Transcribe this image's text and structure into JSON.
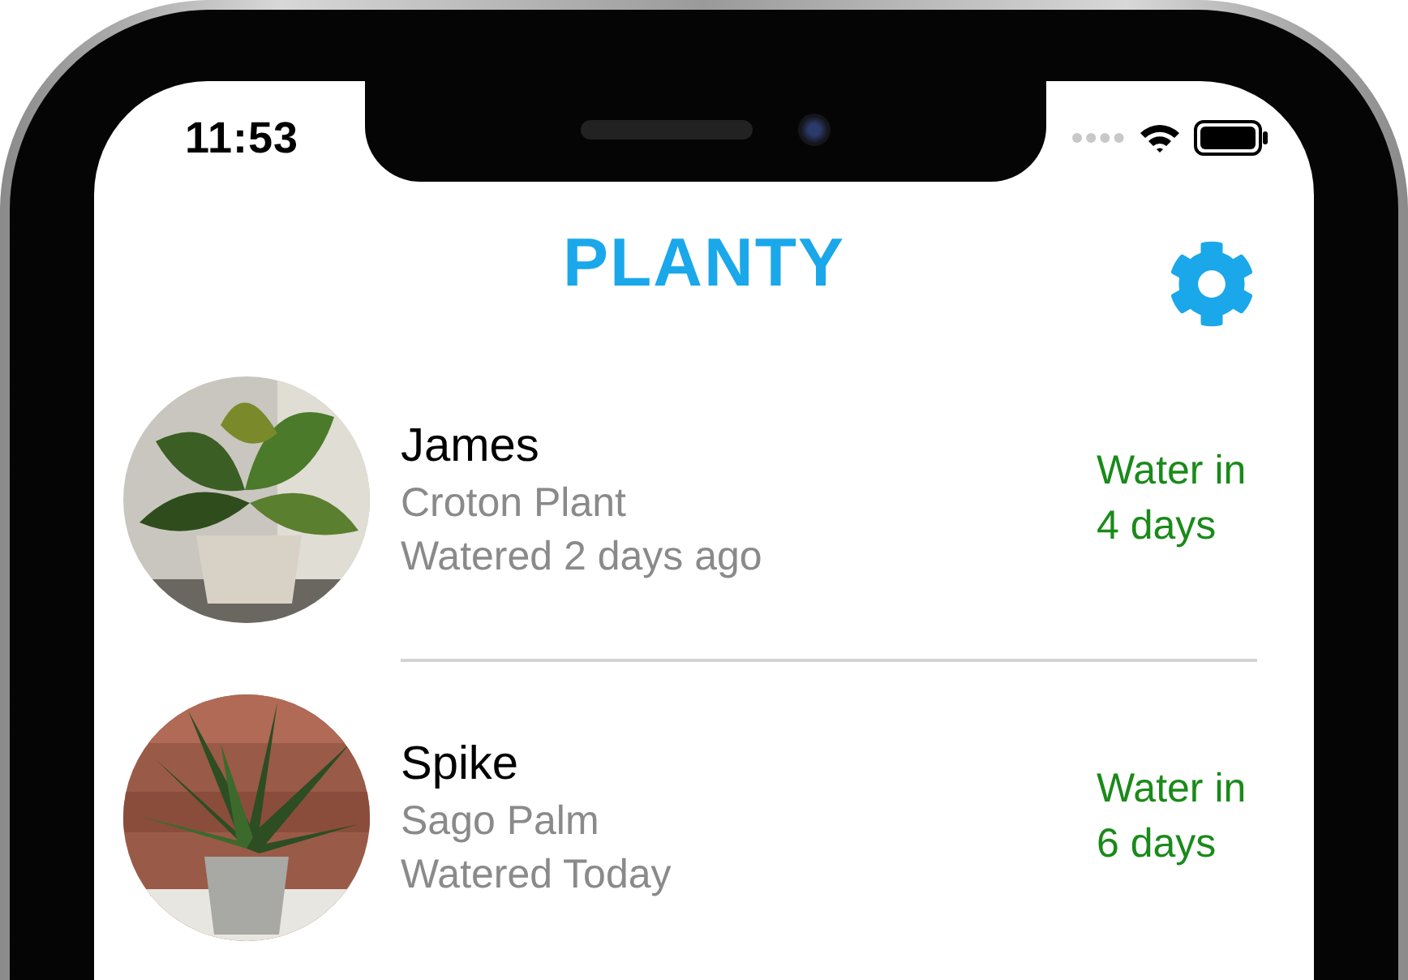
{
  "status_bar": {
    "time": "11:53"
  },
  "header": {
    "title": "PLANTY"
  },
  "plants": [
    {
      "name": "James",
      "species": "Croton Plant",
      "watered": "Watered 2 days ago",
      "water_due": "Water in 4 days"
    },
    {
      "name": "Spike",
      "species": "Sago Palm",
      "watered": "Watered Today",
      "water_due": "Water in 6 days"
    }
  ]
}
